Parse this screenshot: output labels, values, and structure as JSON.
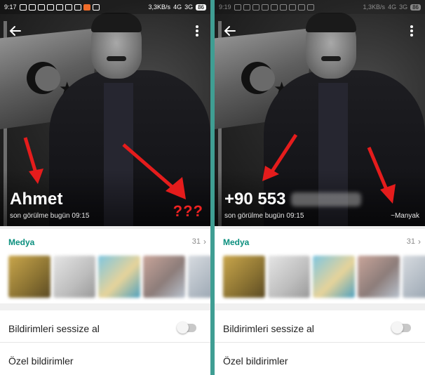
{
  "divider_color": "#3f9e93",
  "accent_color": "#0b8f7e",
  "arrow_color": "#e51c1c",
  "panels": [
    {
      "statusbar": {
        "time": "9:17",
        "network_speed": "3,3KB/s",
        "signal_1": "4G",
        "signal_2": "3G",
        "battery": "86"
      },
      "contact": {
        "name": "Ahmet",
        "last_seen": "son görülme bugün 09:15",
        "annotation": "???"
      },
      "media": {
        "label": "Medya",
        "count": "31"
      },
      "settings": {
        "mute_label": "Bildirimleri sessize al",
        "mute_enabled": false,
        "custom_label": "Özel bildirimler"
      }
    },
    {
      "statusbar": {
        "time": "9:19",
        "network_speed": "1,3KB/s",
        "signal_1": "4G",
        "signal_2": "3G",
        "battery": "86"
      },
      "contact": {
        "phone_visible": "+90 553",
        "last_seen": "son görülme bugün 09:15",
        "push_name": "~Manyak"
      },
      "media": {
        "label": "Medya",
        "count": "31"
      },
      "settings": {
        "mute_label": "Bildirimleri sessize al",
        "mute_enabled": false,
        "custom_label": "Özel bildirimler"
      }
    }
  ]
}
